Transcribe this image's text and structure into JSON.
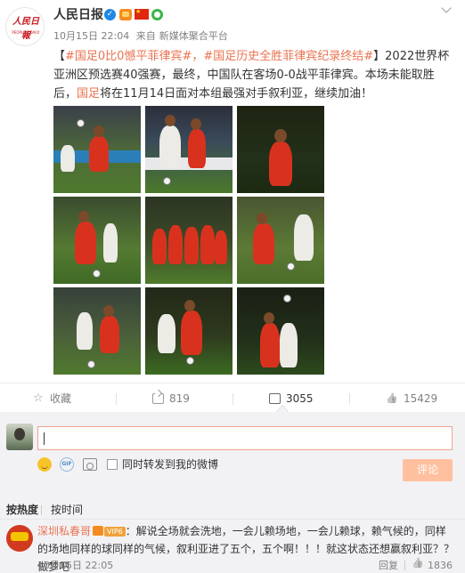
{
  "post": {
    "author": "人民日报",
    "avatar_text": "人民日報",
    "avatar_sub": "PEOPLE'S DAILY",
    "date": "10月15日 22:04",
    "source_prefix": "来自",
    "source": "新媒体聚合平台",
    "text_start": "【",
    "topic1": "#国足0比0憾平菲律宾#",
    "comma1": "，",
    "topic2": "#国足历史全胜菲律宾纪录终结#",
    "text_mid": "】2022世界杯亚洲区预选赛40强赛，最终，中国队在客场0-0战平菲律宾。本场未能取胜后，",
    "red_word": "国足",
    "text_end": "将在11月14日面对本组最强对手叙利亚，继续加油！"
  },
  "actions": {
    "favorite": "收藏",
    "forward": "819",
    "comment": "3055",
    "like": "15429"
  },
  "composer": {
    "gif_label": "GIF",
    "repost_label": "同时转发到我的微博",
    "submit": "评论"
  },
  "sort": {
    "hot": "按热度",
    "time": "按时间"
  },
  "comment": {
    "user": "深圳私春哥",
    "level": "VIP6",
    "text": "：解说全场就会洗地，一会儿赖场地，一会儿赖球，赖气候的，同样的场地同样的球同样的气候，叙利亚进了五个，五个啊！！！就这状态还想赢叙利亚？？做梦吧",
    "date": "10月15日 22:05",
    "reply": "回复",
    "likes": "1836"
  }
}
